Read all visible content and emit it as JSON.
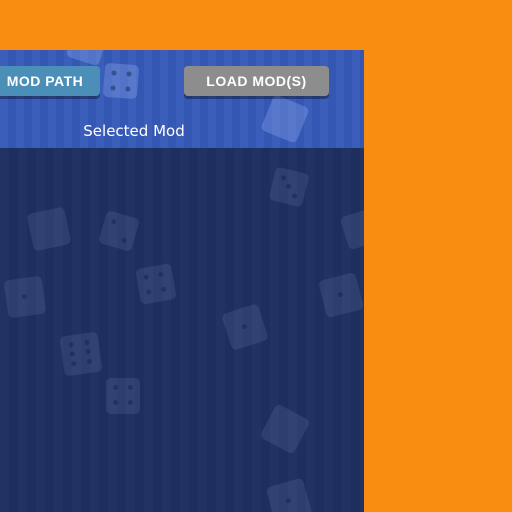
{
  "header": {
    "title_fragment": ""
  },
  "toolbar": {
    "mod_path_label": "MOD PATH",
    "load_mods_label": "LOAD MOD(S)"
  },
  "panel": {
    "selected_label": "Selected Mod"
  },
  "colors": {
    "background": "#f98d12",
    "panel_header": "#3559b8",
    "panel_body": "#1f2f61",
    "mod_path_button": "#4b8fb8",
    "load_mods_button": "#8d8d8d"
  },
  "decorations": {
    "icon": "dice-icon"
  }
}
